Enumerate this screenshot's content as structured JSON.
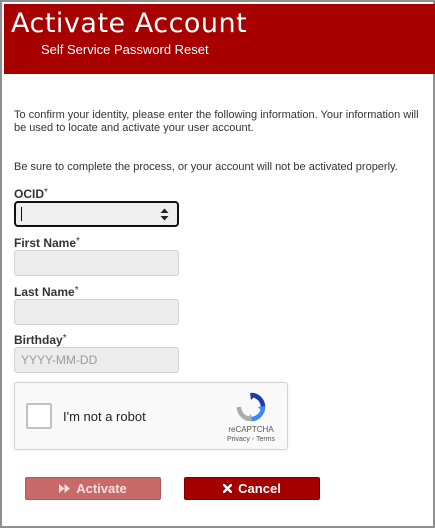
{
  "header": {
    "title": "Activate Account",
    "subtitle": "Self Service Password Reset"
  },
  "intro_text": "To confirm your identity, please enter the following information. Your information will be used to locate and activate your user account.",
  "warning_text": "Be sure to complete the process, or your account will not be activated properly.",
  "form": {
    "ocid": {
      "label": "OCID",
      "required_mark": "*",
      "value": ""
    },
    "first_name": {
      "label": "First Name",
      "required_mark": "*",
      "value": ""
    },
    "last_name": {
      "label": "Last Name",
      "required_mark": "*",
      "value": ""
    },
    "birthday": {
      "label": "Birthday",
      "required_mark": "*",
      "placeholder": "YYYY-MM-DD",
      "value": ""
    }
  },
  "captcha": {
    "label": "I'm not a robot",
    "brand": "reCAPTCHA",
    "links": "Privacy - Terms",
    "checked": false
  },
  "buttons": {
    "activate": {
      "label": "Activate",
      "icon": "fast-forward-icon",
      "enabled": false
    },
    "cancel": {
      "label": "Cancel",
      "icon": "close-icon",
      "enabled": true
    }
  },
  "colors": {
    "header_bg": "#a80000",
    "cancel_bg": "#a50000",
    "activate_disabled_bg": "#c86a6a"
  }
}
